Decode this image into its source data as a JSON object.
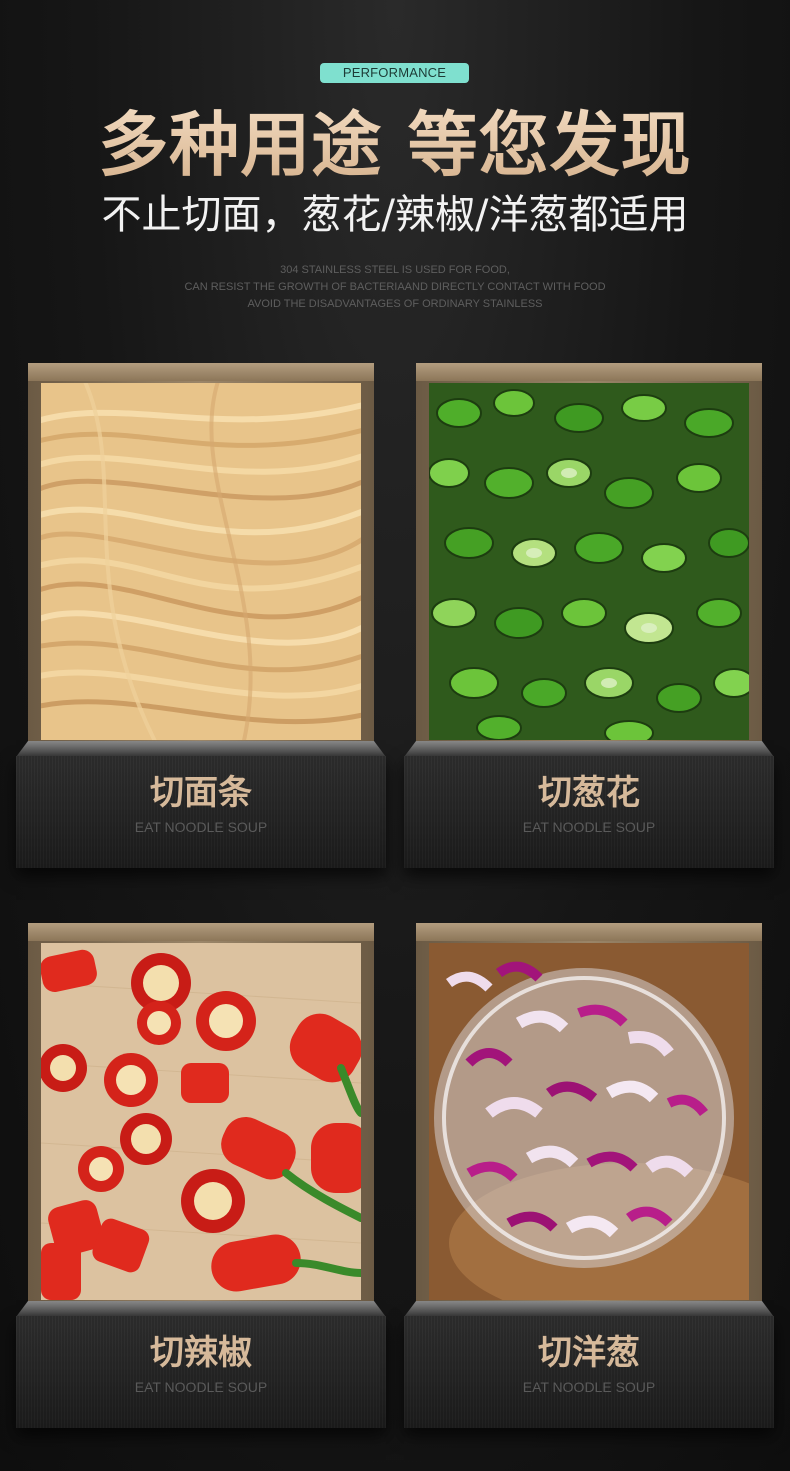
{
  "header": {
    "badge": "PERFORMANCE",
    "title": "多种用途 等您发现",
    "subtitle": "不止切面，葱花/辣椒/洋葱都适用",
    "description_lines": [
      "304 STAINLESS STEEL IS USED FOR FOOD,",
      "CAN RESIST THE GROWTH OF BACTERIAAND DIRECTLY CONTACT WITH FOOD",
      "AVOID THE DISADVANTAGES OF ORDINARY STAINLESS"
    ]
  },
  "cards": [
    {
      "title": "切面条",
      "subtitle": "EAT NOODLE SOUP",
      "image": "noodles-photo"
    },
    {
      "title": "切葱花",
      "subtitle": "EAT NOODLE SOUP",
      "image": "scallions-photo"
    },
    {
      "title": "切辣椒",
      "subtitle": "EAT NOODLE SOUP",
      "image": "chili-photo"
    },
    {
      "title": "切洋葱",
      "subtitle": "EAT NOODLE SOUP",
      "image": "onion-photo"
    }
  ],
  "colors": {
    "badge_bg": "#7fe0cf",
    "title_gold": "#e6c8a6",
    "frame_gold": "#9a8568",
    "background": "#161616"
  }
}
